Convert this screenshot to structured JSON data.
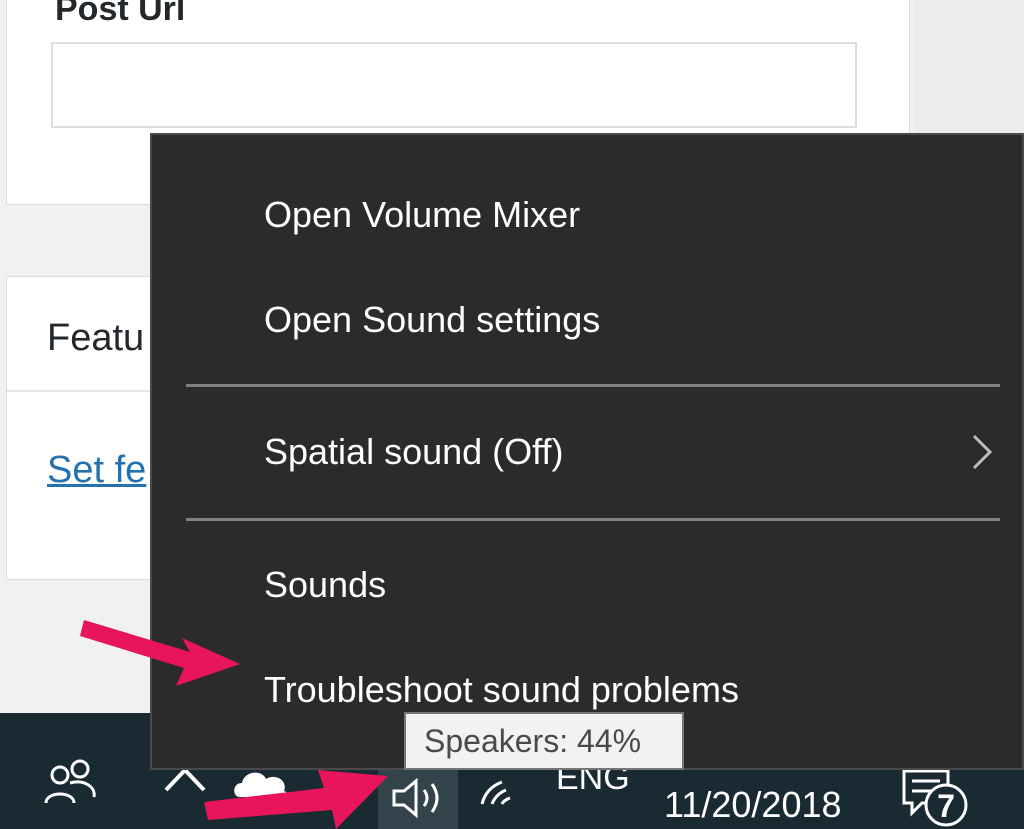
{
  "page": {
    "post_url_label": "Post Url",
    "post_url_value": "",
    "featured_title": "Featu",
    "set_featured_link": "Set fe"
  },
  "context_menu": {
    "items": [
      {
        "label": "Open Volume Mixer"
      },
      {
        "label": "Open Sound settings"
      },
      {
        "label": "Spatial sound (Off)",
        "has_submenu": true
      },
      {
        "label": "Sounds"
      },
      {
        "label": "Troubleshoot sound problems"
      }
    ],
    "background_color": "#2b2b2b"
  },
  "tooltip": {
    "text": "Speakers: 44%"
  },
  "taskbar": {
    "language": "ENG",
    "date": "11/20/2018",
    "notification_count": "7",
    "background_color": "#1a2a33",
    "icons": [
      "people-icon",
      "chevron-up-icon",
      "onedrive-icon",
      "speaker-icon",
      "network-icon",
      "notification-icon"
    ]
  },
  "annotations": {
    "arrow_color": "#e8155a",
    "arrows": [
      "points-to-troubleshoot-item",
      "points-to-speaker-icon"
    ]
  }
}
